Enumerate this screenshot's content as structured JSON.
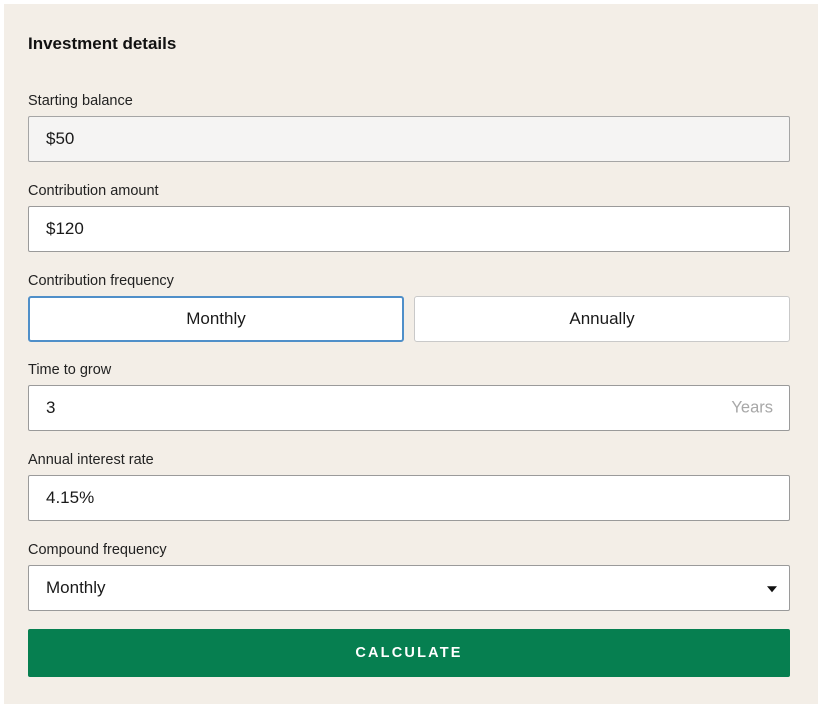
{
  "form": {
    "title": "Investment details",
    "starting_balance": {
      "label": "Starting balance",
      "value": "$50"
    },
    "contribution_amount": {
      "label": "Contribution amount",
      "value": "$120"
    },
    "contribution_frequency": {
      "label": "Contribution frequency",
      "options": [
        "Monthly",
        "Annually"
      ],
      "selected": "Monthly"
    },
    "time_to_grow": {
      "label": "Time to grow",
      "value": "3",
      "suffix": "Years"
    },
    "annual_interest_rate": {
      "label": "Annual interest rate",
      "value": "4.15%"
    },
    "compound_frequency": {
      "label": "Compound frequency",
      "selected": "Monthly",
      "icon": "caret-down-icon"
    },
    "calculate_label": "CALCULATE"
  },
  "colors": {
    "panel_background": "#f3eee7",
    "button_green": "#067f50",
    "active_toggle_border": "#4f8fc9"
  }
}
